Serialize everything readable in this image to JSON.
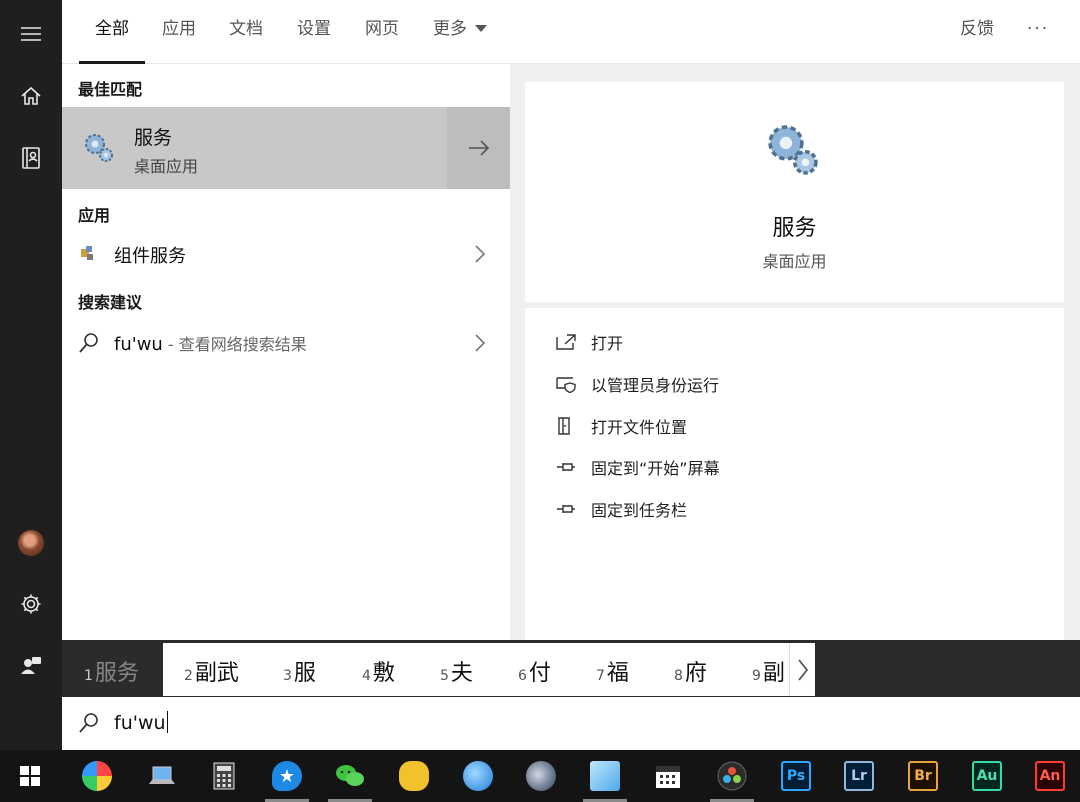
{
  "tabs": {
    "all": "全部",
    "apps": "应用",
    "docs": "文档",
    "settings": "设置",
    "web": "网页",
    "more": "更多",
    "feedback": "反馈",
    "options": "···"
  },
  "results": {
    "best_match_heading": "最佳匹配",
    "best_match": {
      "title": "服务",
      "subtitle": "桌面应用"
    },
    "apps_heading": "应用",
    "app_item": {
      "title": "组件服务"
    },
    "suggest_heading": "搜索建议",
    "suggest_item": {
      "query": "fu'wu",
      "suffix": " - 查看网络搜索结果"
    }
  },
  "detail": {
    "title": "服务",
    "subtitle": "桌面应用",
    "actions": {
      "open": "打开",
      "run_admin": "以管理员身份运行",
      "open_location": "打开文件位置",
      "pin_start": "固定到“开始”屏幕",
      "pin_taskbar": "固定到任务栏"
    }
  },
  "ime": {
    "candidates": [
      {
        "n": "1",
        "text": "服务"
      },
      {
        "n": "2",
        "text": "副武"
      },
      {
        "n": "3",
        "text": "服"
      },
      {
        "n": "4",
        "text": "敷"
      },
      {
        "n": "5",
        "text": "夫"
      },
      {
        "n": "6",
        "text": "付"
      },
      {
        "n": "7",
        "text": "福"
      },
      {
        "n": "8",
        "text": "府"
      },
      {
        "n": "9",
        "text": "副"
      }
    ]
  },
  "search": {
    "value": "fu'wu"
  },
  "taskbar": {
    "ps": "Ps",
    "lr": "Lr",
    "br": "Br",
    "au": "Au",
    "an": "An"
  },
  "colors": {
    "rail": "#1f1f1f",
    "selected_row": "#c8c8c8",
    "ime_bar": "#2b2b2b",
    "taskbar": "#141414"
  }
}
